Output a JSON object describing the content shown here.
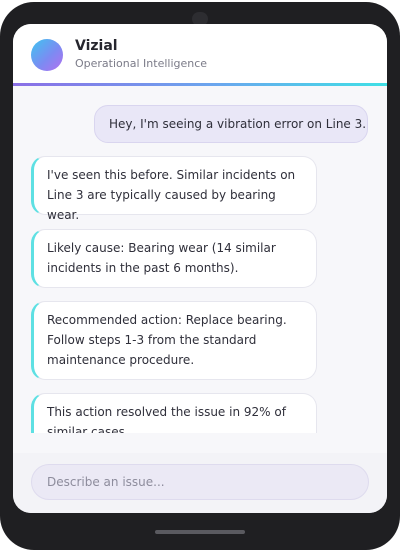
{
  "header": {
    "title": "Vizial",
    "subtitle": "Operational Intelligence",
    "avatar_icon": "gradient-circle-logo"
  },
  "colors": {
    "accent_start": "#8b6fe6",
    "accent_end": "#3fe0e6",
    "user_bubble": "#e9e7f7",
    "bot_accent": "#5ee0e3"
  },
  "messages": {
    "user": [
      {
        "text": "Hey, I'm seeing a vibration error on Line 3."
      }
    ],
    "assistant": [
      {
        "lines": [
          "I've seen this before. Similar incidents on",
          "Line 3 are typically caused by bearing wear."
        ]
      },
      {
        "lines": [
          "Likely cause: Bearing wear (14 similar",
          "incidents in the past 6 months)."
        ]
      },
      {
        "lines": [
          "Recommended action: Replace bearing.",
          "Follow steps 1-3 from the standard",
          "maintenance procedure."
        ]
      },
      {
        "lines": [
          "This action resolved the issue in 92% of",
          "similar cases."
        ]
      }
    ]
  },
  "composer": {
    "placeholder": "Describe an issue..."
  }
}
